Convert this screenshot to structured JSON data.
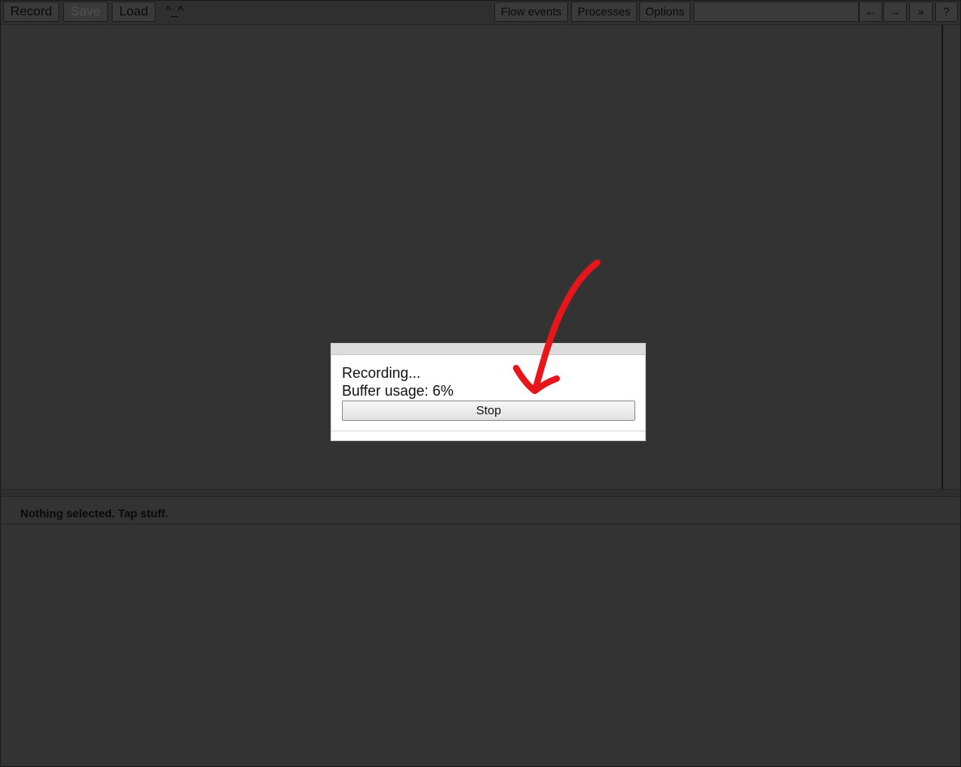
{
  "toolbar": {
    "record": "Record",
    "save": "Save",
    "load": "Load",
    "emoticon": "^_^",
    "flow_events": "Flow events",
    "processes": "Processes",
    "options": "Options",
    "search_value": "",
    "prev_glyph": "←",
    "next_glyph": "→",
    "more_glyph": "»",
    "help_glyph": "?"
  },
  "analysis": {
    "message": "Nothing selected. Tap stuff."
  },
  "dialog": {
    "status": "Recording...",
    "buffer_usage": "Buffer usage: 6%",
    "stop": "Stop"
  },
  "annotation": {
    "arrow_color": "#e8161b",
    "icon": "hand-drawn-arrow-icon"
  },
  "colors": {
    "background": "#333333",
    "dialog_bg": "#ffffff"
  }
}
